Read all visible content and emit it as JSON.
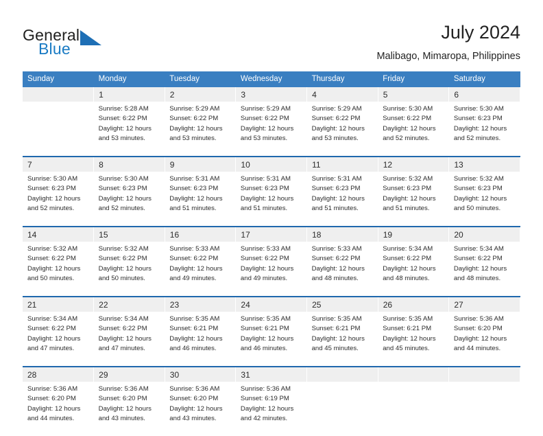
{
  "brand": {
    "name_part1": "General",
    "name_part2": "Blue",
    "accent_color": "#1e6fb5"
  },
  "header": {
    "title": "July 2024",
    "subtitle": "Malibago, Mimaropa, Philippines"
  },
  "calendar": {
    "header_bg": "#3a7fc1",
    "separator_color": "#1f68ad",
    "daynum_bg": "#efefef",
    "weekdays": [
      "Sunday",
      "Monday",
      "Tuesday",
      "Wednesday",
      "Thursday",
      "Friday",
      "Saturday"
    ],
    "weeks": [
      [
        {
          "day": "",
          "sunrise": "",
          "sunset": "",
          "daylight1": "",
          "daylight2": ""
        },
        {
          "day": "1",
          "sunrise": "Sunrise: 5:28 AM",
          "sunset": "Sunset: 6:22 PM",
          "daylight1": "Daylight: 12 hours",
          "daylight2": "and 53 minutes."
        },
        {
          "day": "2",
          "sunrise": "Sunrise: 5:29 AM",
          "sunset": "Sunset: 6:22 PM",
          "daylight1": "Daylight: 12 hours",
          "daylight2": "and 53 minutes."
        },
        {
          "day": "3",
          "sunrise": "Sunrise: 5:29 AM",
          "sunset": "Sunset: 6:22 PM",
          "daylight1": "Daylight: 12 hours",
          "daylight2": "and 53 minutes."
        },
        {
          "day": "4",
          "sunrise": "Sunrise: 5:29 AM",
          "sunset": "Sunset: 6:22 PM",
          "daylight1": "Daylight: 12 hours",
          "daylight2": "and 53 minutes."
        },
        {
          "day": "5",
          "sunrise": "Sunrise: 5:30 AM",
          "sunset": "Sunset: 6:22 PM",
          "daylight1": "Daylight: 12 hours",
          "daylight2": "and 52 minutes."
        },
        {
          "day": "6",
          "sunrise": "Sunrise: 5:30 AM",
          "sunset": "Sunset: 6:23 PM",
          "daylight1": "Daylight: 12 hours",
          "daylight2": "and 52 minutes."
        }
      ],
      [
        {
          "day": "7",
          "sunrise": "Sunrise: 5:30 AM",
          "sunset": "Sunset: 6:23 PM",
          "daylight1": "Daylight: 12 hours",
          "daylight2": "and 52 minutes."
        },
        {
          "day": "8",
          "sunrise": "Sunrise: 5:30 AM",
          "sunset": "Sunset: 6:23 PM",
          "daylight1": "Daylight: 12 hours",
          "daylight2": "and 52 minutes."
        },
        {
          "day": "9",
          "sunrise": "Sunrise: 5:31 AM",
          "sunset": "Sunset: 6:23 PM",
          "daylight1": "Daylight: 12 hours",
          "daylight2": "and 51 minutes."
        },
        {
          "day": "10",
          "sunrise": "Sunrise: 5:31 AM",
          "sunset": "Sunset: 6:23 PM",
          "daylight1": "Daylight: 12 hours",
          "daylight2": "and 51 minutes."
        },
        {
          "day": "11",
          "sunrise": "Sunrise: 5:31 AM",
          "sunset": "Sunset: 6:23 PM",
          "daylight1": "Daylight: 12 hours",
          "daylight2": "and 51 minutes."
        },
        {
          "day": "12",
          "sunrise": "Sunrise: 5:32 AM",
          "sunset": "Sunset: 6:23 PM",
          "daylight1": "Daylight: 12 hours",
          "daylight2": "and 51 minutes."
        },
        {
          "day": "13",
          "sunrise": "Sunrise: 5:32 AM",
          "sunset": "Sunset: 6:23 PM",
          "daylight1": "Daylight: 12 hours",
          "daylight2": "and 50 minutes."
        }
      ],
      [
        {
          "day": "14",
          "sunrise": "Sunrise: 5:32 AM",
          "sunset": "Sunset: 6:22 PM",
          "daylight1": "Daylight: 12 hours",
          "daylight2": "and 50 minutes."
        },
        {
          "day": "15",
          "sunrise": "Sunrise: 5:32 AM",
          "sunset": "Sunset: 6:22 PM",
          "daylight1": "Daylight: 12 hours",
          "daylight2": "and 50 minutes."
        },
        {
          "day": "16",
          "sunrise": "Sunrise: 5:33 AM",
          "sunset": "Sunset: 6:22 PM",
          "daylight1": "Daylight: 12 hours",
          "daylight2": "and 49 minutes."
        },
        {
          "day": "17",
          "sunrise": "Sunrise: 5:33 AM",
          "sunset": "Sunset: 6:22 PM",
          "daylight1": "Daylight: 12 hours",
          "daylight2": "and 49 minutes."
        },
        {
          "day": "18",
          "sunrise": "Sunrise: 5:33 AM",
          "sunset": "Sunset: 6:22 PM",
          "daylight1": "Daylight: 12 hours",
          "daylight2": "and 48 minutes."
        },
        {
          "day": "19",
          "sunrise": "Sunrise: 5:34 AM",
          "sunset": "Sunset: 6:22 PM",
          "daylight1": "Daylight: 12 hours",
          "daylight2": "and 48 minutes."
        },
        {
          "day": "20",
          "sunrise": "Sunrise: 5:34 AM",
          "sunset": "Sunset: 6:22 PM",
          "daylight1": "Daylight: 12 hours",
          "daylight2": "and 48 minutes."
        }
      ],
      [
        {
          "day": "21",
          "sunrise": "Sunrise: 5:34 AM",
          "sunset": "Sunset: 6:22 PM",
          "daylight1": "Daylight: 12 hours",
          "daylight2": "and 47 minutes."
        },
        {
          "day": "22",
          "sunrise": "Sunrise: 5:34 AM",
          "sunset": "Sunset: 6:22 PM",
          "daylight1": "Daylight: 12 hours",
          "daylight2": "and 47 minutes."
        },
        {
          "day": "23",
          "sunrise": "Sunrise: 5:35 AM",
          "sunset": "Sunset: 6:21 PM",
          "daylight1": "Daylight: 12 hours",
          "daylight2": "and 46 minutes."
        },
        {
          "day": "24",
          "sunrise": "Sunrise: 5:35 AM",
          "sunset": "Sunset: 6:21 PM",
          "daylight1": "Daylight: 12 hours",
          "daylight2": "and 46 minutes."
        },
        {
          "day": "25",
          "sunrise": "Sunrise: 5:35 AM",
          "sunset": "Sunset: 6:21 PM",
          "daylight1": "Daylight: 12 hours",
          "daylight2": "and 45 minutes."
        },
        {
          "day": "26",
          "sunrise": "Sunrise: 5:35 AM",
          "sunset": "Sunset: 6:21 PM",
          "daylight1": "Daylight: 12 hours",
          "daylight2": "and 45 minutes."
        },
        {
          "day": "27",
          "sunrise": "Sunrise: 5:36 AM",
          "sunset": "Sunset: 6:20 PM",
          "daylight1": "Daylight: 12 hours",
          "daylight2": "and 44 minutes."
        }
      ],
      [
        {
          "day": "28",
          "sunrise": "Sunrise: 5:36 AM",
          "sunset": "Sunset: 6:20 PM",
          "daylight1": "Daylight: 12 hours",
          "daylight2": "and 44 minutes."
        },
        {
          "day": "29",
          "sunrise": "Sunrise: 5:36 AM",
          "sunset": "Sunset: 6:20 PM",
          "daylight1": "Daylight: 12 hours",
          "daylight2": "and 43 minutes."
        },
        {
          "day": "30",
          "sunrise": "Sunrise: 5:36 AM",
          "sunset": "Sunset: 6:20 PM",
          "daylight1": "Daylight: 12 hours",
          "daylight2": "and 43 minutes."
        },
        {
          "day": "31",
          "sunrise": "Sunrise: 5:36 AM",
          "sunset": "Sunset: 6:19 PM",
          "daylight1": "Daylight: 12 hours",
          "daylight2": "and 42 minutes."
        },
        {
          "day": "",
          "sunrise": "",
          "sunset": "",
          "daylight1": "",
          "daylight2": ""
        },
        {
          "day": "",
          "sunrise": "",
          "sunset": "",
          "daylight1": "",
          "daylight2": ""
        },
        {
          "day": "",
          "sunrise": "",
          "sunset": "",
          "daylight1": "",
          "daylight2": ""
        }
      ]
    ]
  }
}
